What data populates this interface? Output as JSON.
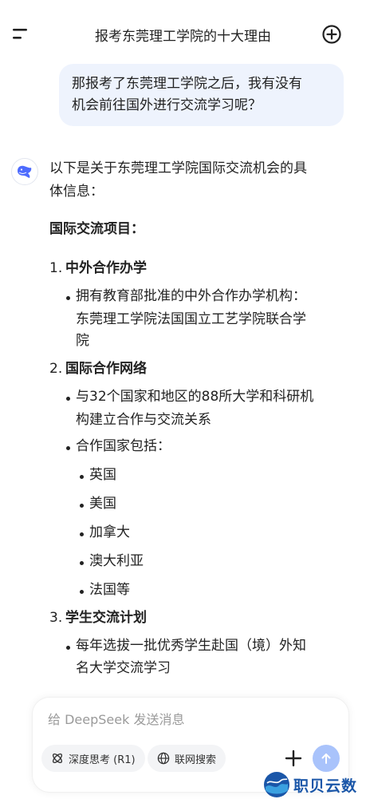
{
  "header": {
    "title": "报考东莞理工学院的十大理由",
    "menu_icon": "hamburger-icon",
    "new_chat_icon": "add-circle-icon"
  },
  "user_message": {
    "line1": "那报考了东莞理工学院之后，我有没有",
    "line2": "机会前往国外进行交流学习呢？"
  },
  "assistant": {
    "avatar_icon": "deepseek-whale-icon",
    "intro_line1": "以下是关于东莞理工学院国际交流机会的具",
    "intro_line2": "体信息：",
    "section_heading": "国际交流项目：",
    "items": [
      {
        "number": "1.",
        "title": "中外合作办学",
        "bullets": [
          [
            "拥有教育部批准的中外合作办学机构：",
            "东莞理工学院法国国立工艺学院联合学",
            "院"
          ]
        ]
      },
      {
        "number": "2.",
        "title": "国际合作网络",
        "bullets": [
          [
            "与32个国家和地区的88所大学和科研机",
            "构建立合作与交流关系"
          ],
          [
            "合作国家包括："
          ]
        ],
        "countries": [
          "英国",
          "美国",
          "加拿大",
          "澳大利亚",
          "法国等"
        ]
      },
      {
        "number": "3.",
        "title": "学生交流计划",
        "bullets": [
          [
            "每年选拔一批优秀学生赴国（境）外知",
            "名大学交流学习"
          ]
        ]
      }
    ]
  },
  "input": {
    "placeholder": "给 DeepSeek 发送消息",
    "deep_think_label": "深度思考 (R1)",
    "web_search_label": "联网搜索",
    "send_color": "#a9c3fb"
  },
  "watermark": {
    "text": "职贝云数"
  },
  "colors": {
    "bubble_bg": "#eef3fd",
    "brand_blue": "#4d6bfe"
  }
}
